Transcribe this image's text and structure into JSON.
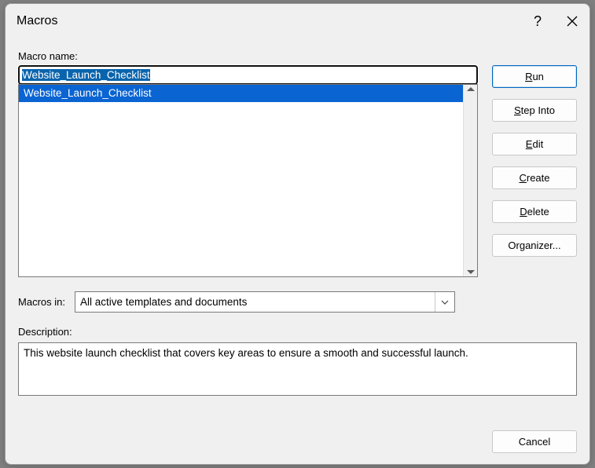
{
  "dialog": {
    "title": "Macros",
    "help": "?",
    "labels": {
      "macro_name": "Macro name:",
      "macros_in": "Macros in:",
      "description": "Description:"
    },
    "name_input": "Website_Launch_Checklist",
    "list": [
      {
        "label": "Website_Launch_Checklist",
        "selected": true
      }
    ],
    "macros_in_value": "All active templates and documents",
    "description_text": "This website launch checklist that covers key areas to ensure a smooth and successful launch."
  },
  "buttons": {
    "run": "Run",
    "step_into": "Step Into",
    "edit": "Edit",
    "create": "Create",
    "delete": "Delete",
    "organizer": "Organizer...",
    "cancel": "Cancel"
  }
}
